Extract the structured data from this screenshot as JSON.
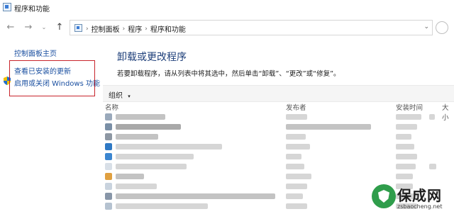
{
  "window": {
    "title": "程序和功能"
  },
  "address_bar": {
    "crumbs": [
      "控制面板",
      "程序",
      "程序和功能"
    ]
  },
  "sidebar": {
    "items": [
      {
        "label": "控制面板主页"
      },
      {
        "label": "查看已安装的更新"
      },
      {
        "label": "启用或关闭 Windows 功能"
      }
    ]
  },
  "main": {
    "title": "卸载或更改程序",
    "description": "若要卸载程序，请从列表中将其选中，然后单击“卸载”、“更改”或“修复”。",
    "toolbar": {
      "organize_label": "组织"
    },
    "columns": [
      "名称",
      "发布者",
      "安装时间",
      "大小"
    ]
  },
  "watermark": {
    "brand": "保成网",
    "url": "zsbaocheng.net"
  },
  "colors": {
    "highlight_box": "#c8242b",
    "link": "#1a4fa0",
    "title": "#1e3f7a"
  }
}
